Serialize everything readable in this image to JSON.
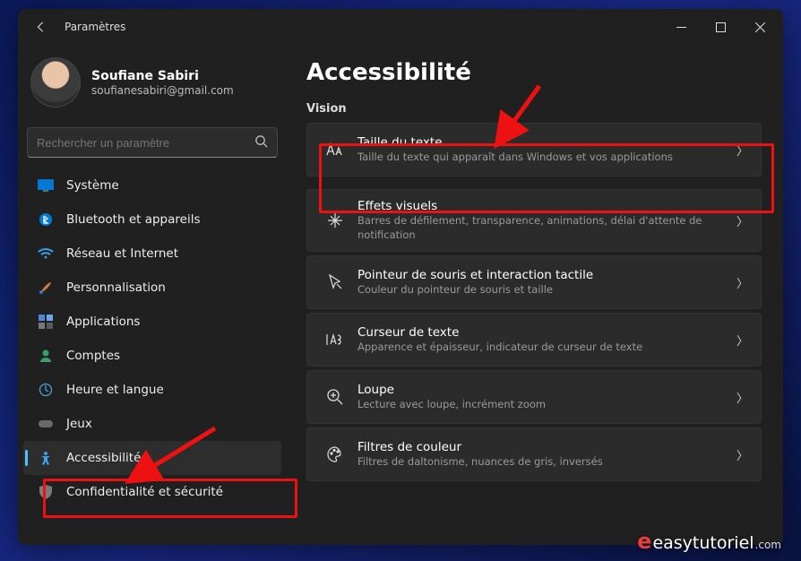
{
  "titlebar": {
    "title": "Paramètres"
  },
  "account": {
    "name": "Soufiane Sabiri",
    "email": "soufianesabiri@gmail.com"
  },
  "search": {
    "placeholder": "Rechercher un paramètre"
  },
  "nav": {
    "items": [
      {
        "label": "Système"
      },
      {
        "label": "Bluetooth et appareils"
      },
      {
        "label": "Réseau et Internet"
      },
      {
        "label": "Personnalisation"
      },
      {
        "label": "Applications"
      },
      {
        "label": "Comptes"
      },
      {
        "label": "Heure et langue"
      },
      {
        "label": "Jeux"
      },
      {
        "label": "Accessibilité"
      },
      {
        "label": "Confidentialité et sécurité"
      }
    ]
  },
  "main": {
    "heading": "Accessibilité",
    "section": "Vision",
    "cards": [
      {
        "title": "Taille du texte",
        "desc": "Taille du texte qui apparaît dans Windows et vos applications"
      },
      {
        "title": "Effets visuels",
        "desc": "Barres de défilement, transparence, animations, délai d'attente de notification"
      },
      {
        "title": "Pointeur de souris et interaction tactile",
        "desc": "Couleur du pointeur de souris et taille"
      },
      {
        "title": "Curseur de texte",
        "desc": "Apparence et épaisseur, indicateur de curseur de texte"
      },
      {
        "title": "Loupe",
        "desc": "Lecture avec loupe, incrément zoom"
      },
      {
        "title": "Filtres de couleur",
        "desc": "Filtres de daltonisme, nuances de gris, inversés"
      }
    ]
  },
  "watermark": {
    "brand_prefix": "e",
    "brand": "easytutoriel",
    "domain": ".com"
  },
  "colors": {
    "highlight": "#e11",
    "accent": "#4cc2ff"
  }
}
